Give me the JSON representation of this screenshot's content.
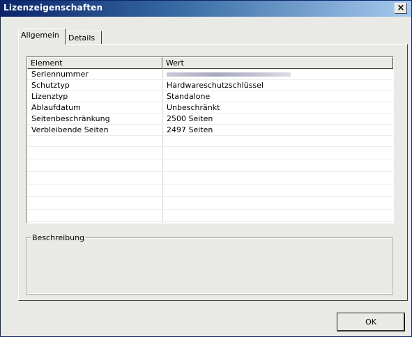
{
  "window": {
    "title": "Lizenzeigenschaften",
    "close_glyph": "×"
  },
  "tabs": [
    {
      "label": "Allgemein",
      "active": true
    },
    {
      "label": "Details",
      "active": false
    }
  ],
  "list": {
    "columns": [
      "Element",
      "Wert"
    ],
    "rows": [
      {
        "key": "Seriennummer",
        "value": ""
      },
      {
        "key": "Schutztyp",
        "value": "Hardwareschutzschlüssel"
      },
      {
        "key": "Lizenztyp",
        "value": "Standalone"
      },
      {
        "key": "Ablaufdatum",
        "value": "Unbeschränkt"
      },
      {
        "key": "Seitenbeschränkung",
        "value": "2500 Seiten"
      },
      {
        "key": "Verbleibende Seiten",
        "value": "2497 Seiten"
      }
    ]
  },
  "description": {
    "label": "Beschreibung",
    "text": ""
  },
  "buttons": {
    "ok": "OK"
  }
}
